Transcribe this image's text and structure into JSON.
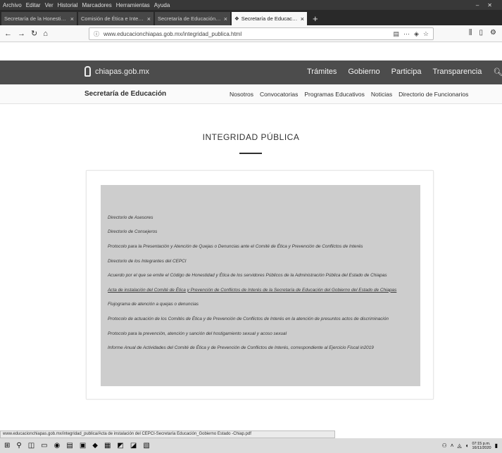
{
  "browser": {
    "menu": [
      "Archivo",
      "Editar",
      "Ver",
      "Historial",
      "Marcadores",
      "Herramientas",
      "Ayuda"
    ],
    "tabs": [
      {
        "label": "Secretaría de la Honestidad y..."
      },
      {
        "label": "Comisión de Ética e Integrid..."
      },
      {
        "label": "Secretaría de Educación del Es..."
      },
      {
        "label": "Secretaría de Educación del Es..."
      }
    ],
    "new_tab_label": "+",
    "url": "www.educacionchiapas.gob.mx/integridad_publica.html"
  },
  "site": {
    "logo_text": "chiapas.gob.mx",
    "top_links": [
      "Trámites",
      "Gobierno",
      "Participa",
      "Transparencia"
    ],
    "department": "Secretaría de Educación",
    "sub_links": [
      "Nosotros",
      "Convocatorias",
      "Programas Educativos",
      "Noticias",
      "Directorio de Funcionarios"
    ]
  },
  "page": {
    "title": "INTEGRIDAD PÚBLICA",
    "documents": [
      "Directorio de Asesores",
      "Directorio de Consejeros",
      "Protocolo para la Presentación y Atención de Quejas o Denuncias ante el Comité de Ética y Prevención de Conflictos de Interés",
      "Directorio de los Integrantes del CEPCI",
      "Acuerdo por el que se emite el Código de Honestidad y Ética de los servidores Públicos de la Administración Pública del Estado de Chiapas",
      "Acta de instalación del Comité de Ética y Prevención de Conflictos de Interés de la Secretaría de Educación del Gobierno del Estado de Chiapas",
      "Flujograma de atención a quejas o denuncias",
      "Protocolo de actuación de los Comités de Ética y de Prevención de Conflictos de Interés en la atención de presuntos actos de discriminación",
      "Protocolo para la prevención, atención y sanción del hostigamiento sexual y acoso sexual",
      "Informe Anual de Actividades del Comité de Ética y de Prevención de Conflictos de Interés, correspondiente al Ejercicio Fiscal in2019"
    ]
  },
  "status": {
    "link_preview": "www.educacionchiapas.gob.mx/integridad_publica/Acta de instalación del CEPCI-Secretaría Educación_Gobierno Estado -Chiap.pdf"
  },
  "taskbar": {
    "time": "07:15 p.m.",
    "date": "16/11/2020"
  }
}
